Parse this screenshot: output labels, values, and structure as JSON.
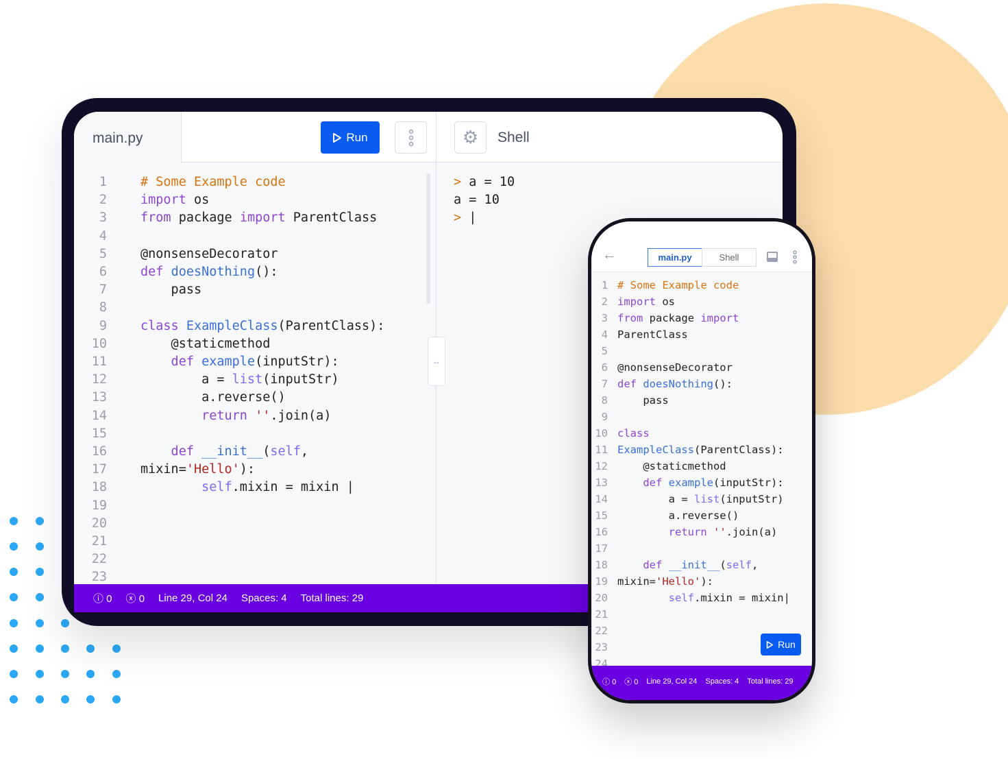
{
  "colors": {
    "accent": "#0a5cf0",
    "status_bar": "#6a00e2",
    "decor_circle": "#fbdcab",
    "decor_dots": "#2ba8f5"
  },
  "tablet": {
    "file_tab": "main.py",
    "run_label": "Run",
    "shell_title": "Shell",
    "shell_lines": [
      [
        [
          "p",
          "> "
        ],
        [
          "d",
          "a = 10"
        ]
      ],
      [
        [
          "d",
          "a = 10"
        ]
      ],
      [
        [
          "p",
          "> "
        ],
        [
          "d",
          "|"
        ]
      ]
    ],
    "code_lines": [
      [
        [
          "c",
          "# Some Example code"
        ]
      ],
      [
        [
          "k",
          "import"
        ],
        [
          "d",
          " os"
        ]
      ],
      [
        [
          "k",
          "from"
        ],
        [
          "d",
          " package "
        ],
        [
          "k",
          "import"
        ],
        [
          "d",
          " ParentClass"
        ]
      ],
      [],
      [
        [
          "d",
          "@nonsenseDecorator"
        ]
      ],
      [
        [
          "k",
          "def "
        ],
        [
          "f",
          "doesNothing"
        ],
        [
          "d",
          "():"
        ]
      ],
      [
        [
          "d",
          "    pass"
        ]
      ],
      [],
      [
        [
          "k",
          "class "
        ],
        [
          "f",
          "ExampleClass"
        ],
        [
          "d",
          "(ParentClass):"
        ]
      ],
      [
        [
          "d",
          "    @staticmethod"
        ]
      ],
      [
        [
          "k",
          "    def "
        ],
        [
          "f",
          "example"
        ],
        [
          "d",
          "(inputStr):"
        ]
      ],
      [
        [
          "d",
          "        a = "
        ],
        [
          "b",
          "list"
        ],
        [
          "d",
          "(inputStr)"
        ]
      ],
      [
        [
          "d",
          "        a.reverse()"
        ]
      ],
      [
        [
          "k",
          "        return "
        ],
        [
          "s",
          "''"
        ],
        [
          "d",
          ".join(a)"
        ]
      ],
      [],
      [
        [
          "k",
          "    def "
        ],
        [
          "f",
          "__init__"
        ],
        [
          "d",
          "("
        ],
        [
          "b",
          "self"
        ],
        [
          "d",
          ","
        ]
      ],
      [
        [
          "d",
          "mixin="
        ],
        [
          "s",
          "'Hello'"
        ],
        [
          "d",
          "):"
        ]
      ],
      [
        [
          "b",
          "        self"
        ],
        [
          "d",
          ".mixin = mixin |"
        ]
      ],
      [],
      [],
      [],
      [],
      []
    ],
    "status": {
      "warnings": "0",
      "errors": "0",
      "position": "Line 29, Col 24",
      "spaces": "Spaces: 4",
      "total": "Total lines: 29"
    }
  },
  "phone": {
    "tabs": [
      "main.py",
      "Shell"
    ],
    "active_tab": "main.py",
    "run_label": "Run",
    "code_lines": [
      [
        [
          "c",
          "# Some Example code"
        ]
      ],
      [
        [
          "k",
          "import"
        ],
        [
          "d",
          " os"
        ]
      ],
      [
        [
          "k",
          "from"
        ],
        [
          "d",
          " package "
        ],
        [
          "k",
          "import"
        ]
      ],
      [
        [
          "d",
          "ParentClass"
        ]
      ],
      [],
      [
        [
          "d",
          "@nonsenseDecorator"
        ]
      ],
      [
        [
          "k",
          "def "
        ],
        [
          "f",
          "doesNothing"
        ],
        [
          "d",
          "():"
        ]
      ],
      [
        [
          "d",
          "    pass"
        ]
      ],
      [],
      [
        [
          "k",
          "class"
        ]
      ],
      [
        [
          "f",
          "ExampleClass"
        ],
        [
          "d",
          "(ParentClass):"
        ]
      ],
      [
        [
          "d",
          "    @staticmethod"
        ]
      ],
      [
        [
          "k",
          "    def "
        ],
        [
          "f",
          "example"
        ],
        [
          "d",
          "(inputStr):"
        ]
      ],
      [
        [
          "d",
          "        a = "
        ],
        [
          "b",
          "list"
        ],
        [
          "d",
          "(inputStr)"
        ]
      ],
      [
        [
          "d",
          "        a.reverse()"
        ]
      ],
      [
        [
          "k",
          "        return "
        ],
        [
          "s",
          "''"
        ],
        [
          "d",
          ".join(a)"
        ]
      ],
      [],
      [
        [
          "k",
          "    def "
        ],
        [
          "f",
          "__init__"
        ],
        [
          "d",
          "("
        ],
        [
          "b",
          "self"
        ],
        [
          "d",
          ","
        ]
      ],
      [
        [
          "d",
          "mixin="
        ],
        [
          "s",
          "'Hello'"
        ],
        [
          "d",
          "):"
        ]
      ],
      [
        [
          "b",
          "        self"
        ],
        [
          "d",
          ".mixin = mixin|"
        ]
      ],
      [],
      [],
      [],
      []
    ],
    "status": {
      "warnings": "0",
      "errors": "0",
      "position": "Line 29, Col 24",
      "spaces": "Spaces: 4",
      "total": "Total lines: 29"
    }
  }
}
